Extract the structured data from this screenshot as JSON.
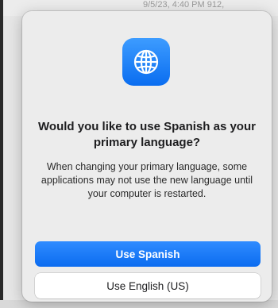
{
  "background": {
    "timestamp_text": "9/5/23, 4:40 PM    912,"
  },
  "dialog": {
    "icon": "globe-icon",
    "title": "Would you like to use Spanish as your primary language?",
    "message": "When changing your primary language, some applications may not use the new language until your computer is restarted.",
    "primary_button": "Use Spanish",
    "secondary_button": "Use English (US)"
  },
  "colors": {
    "accent": "#0b6cf0",
    "dialog_bg": "#ececec"
  }
}
